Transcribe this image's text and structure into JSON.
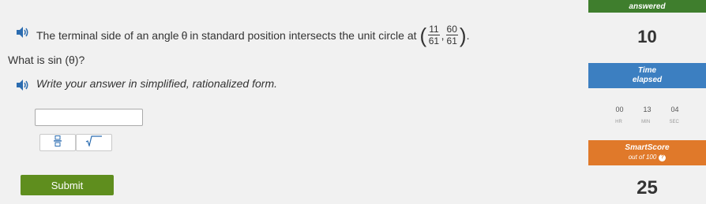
{
  "question": {
    "intro_text": "The terminal side of an angle",
    "theta": "θ",
    "middle_text": "in standard position intersects the unit circle at",
    "point": {
      "x_numerator": "11",
      "x_denominator": "61",
      "y_numerator": "60",
      "y_denominator": "61"
    },
    "trailing_period": ".",
    "prompt": "What is sin (θ)?",
    "instruction": "Write your answer in simplified, rationalized form."
  },
  "answer": {
    "value": "",
    "placeholder": ""
  },
  "tools": {
    "fraction_icon": "fraction-icon",
    "sqrt_icon": "square-root-icon"
  },
  "submit": {
    "label": "Submit"
  },
  "sidebar": {
    "answered_label": "answered",
    "answered_count": "10",
    "time_label_line1": "Time",
    "time_label_line2": "elapsed",
    "time": {
      "hours": "00",
      "minutes": "13",
      "seconds": "04"
    },
    "time_units": {
      "hours": "HR",
      "minutes": "MIN",
      "seconds": "SEC"
    },
    "smartscore_label": "SmartScore",
    "smartscore_sub": "out of 100",
    "smartscore_value": "25"
  },
  "colors": {
    "answered_green": "#3f7e2d",
    "time_blue": "#3c7fc1",
    "score_orange": "#e0792a",
    "submit_green": "#5f8e1e",
    "speaker_blue": "#2b6cb0"
  }
}
